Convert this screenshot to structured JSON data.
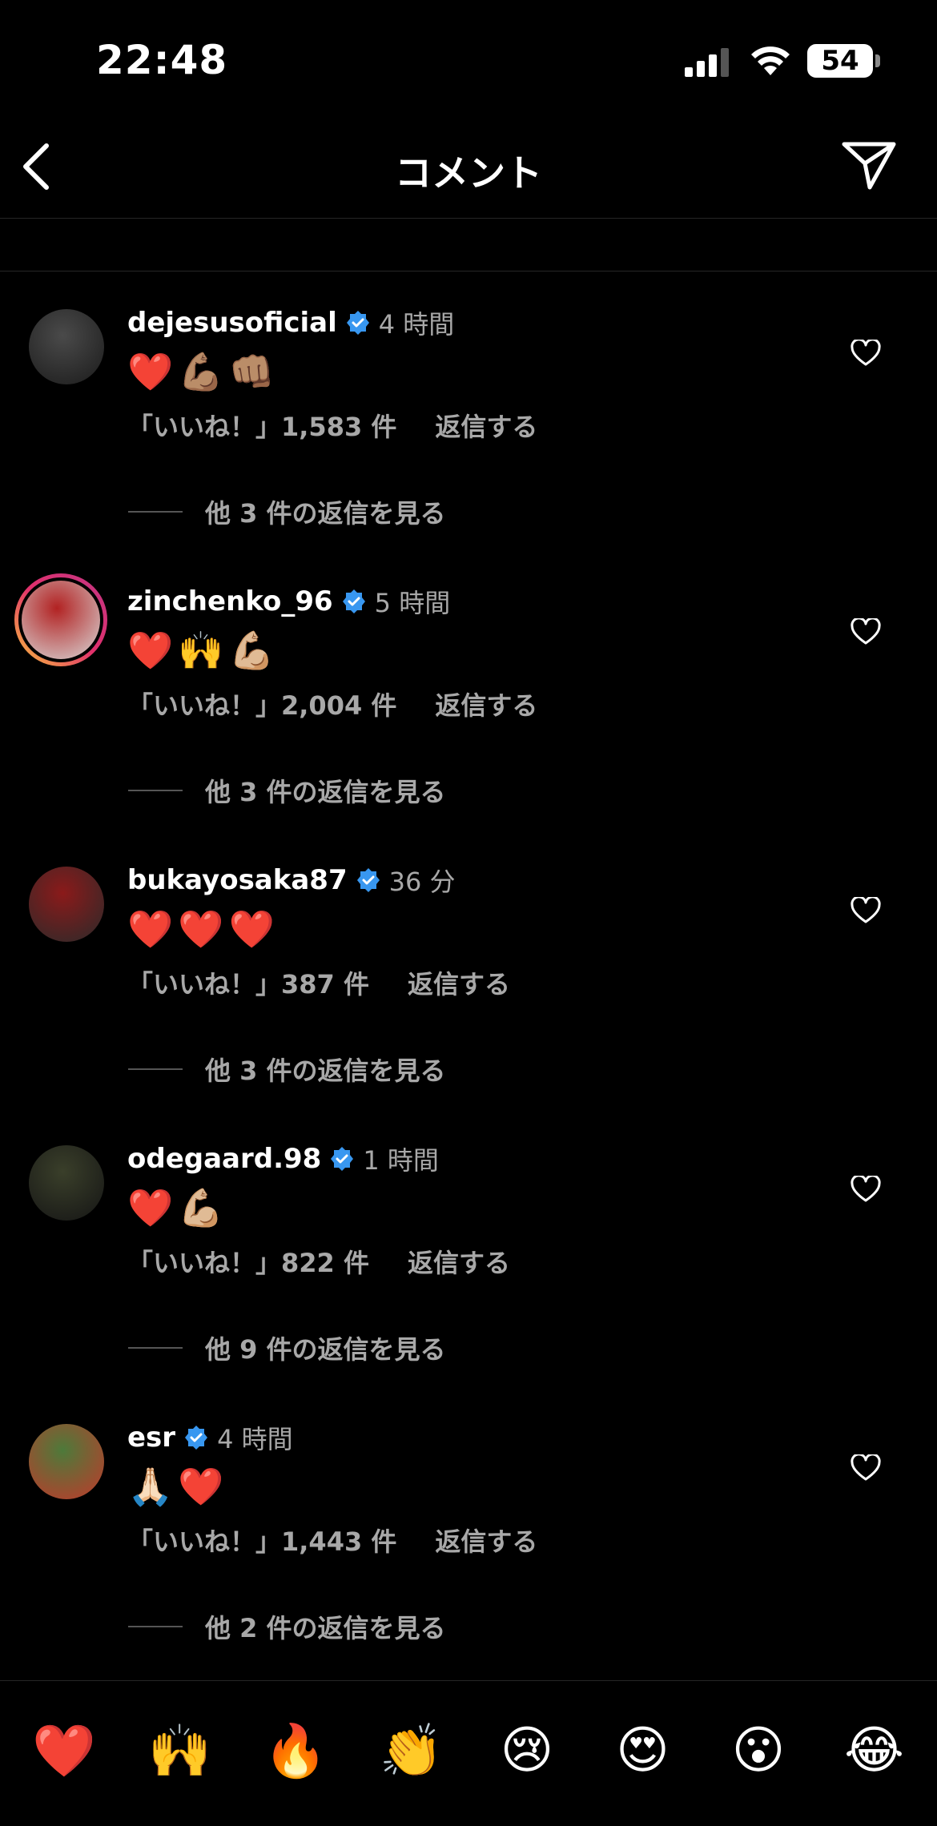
{
  "status_bar": {
    "time": "22:48",
    "battery": "54"
  },
  "header": {
    "title": "コメント"
  },
  "comments": [
    {
      "username": "dejesusoficial",
      "time": "4 時間",
      "text": "❤️💪🏽👊🏽",
      "likes": "「いいね！」1,583 件",
      "reply": "返信する",
      "view_replies": "他 3 件の返信を見る",
      "avatar_colors": [
        "#4a4a4a",
        "#1b1b1b"
      ],
      "story_ring": false
    },
    {
      "username": "zinchenko_96",
      "time": "5 時間",
      "text": "❤️🙌💪🏼",
      "likes": "「いいね！」2,004 件",
      "reply": "返信する",
      "view_replies": "他 3 件の返信を見る",
      "avatar_colors": [
        "#b22222",
        "#d9d9d9"
      ],
      "story_ring": true
    },
    {
      "username": "bukayosaka87",
      "time": "36 分",
      "text": "❤️❤️❤️",
      "likes": "「いいね！」387 件",
      "reply": "返信する",
      "view_replies": "他 3 件の返信を見る",
      "avatar_colors": [
        "#8b1a1a",
        "#2a2a2a"
      ],
      "story_ring": false
    },
    {
      "username": "odegaard.98",
      "time": "1 時間",
      "text": "❤️💪🏼",
      "likes": "「いいね！」822 件",
      "reply": "返信する",
      "view_replies": "他 9 件の返信を見る",
      "avatar_colors": [
        "#3a3f2a",
        "#151515"
      ],
      "story_ring": false
    },
    {
      "username": "esr",
      "time": "4 時間",
      "text": "🙏🏻❤️",
      "likes": "「いいね！」1,443 件",
      "reply": "返信する",
      "view_replies": "他 2 件の返信を見る",
      "avatar_colors": [
        "#4d7a3a",
        "#c0392b"
      ],
      "story_ring": false
    }
  ],
  "reactions": [
    "❤️",
    "🙌",
    "🔥",
    "👏",
    "😢",
    "😍",
    "😮",
    "😂"
  ],
  "colors": {
    "verified": "#3897f0",
    "secondary_text": "#a8a8a8"
  }
}
